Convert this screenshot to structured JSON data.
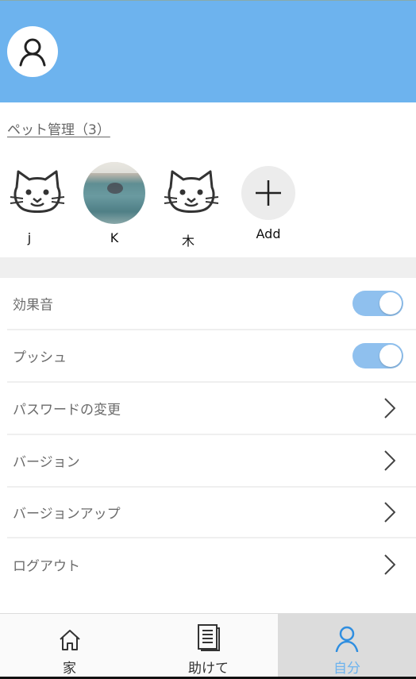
{
  "pets_section": {
    "title": "ペット管理（3）",
    "pets": [
      {
        "name": "j"
      },
      {
        "name": "K"
      },
      {
        "name": "木"
      }
    ],
    "add_label": "Add"
  },
  "settings": {
    "sound_effects": {
      "label": "効果音",
      "enabled": true
    },
    "push": {
      "label": "プッシュ",
      "enabled": true
    },
    "change_password": {
      "label": "パスワードの変更"
    },
    "version": {
      "label": "バージョン"
    },
    "version_up": {
      "label": "バージョンアップ"
    },
    "logout": {
      "label": "ログアウト"
    }
  },
  "tabbar": {
    "home": {
      "label": "家",
      "icon": "home-icon"
    },
    "help": {
      "label": "助けて",
      "icon": "document-icon"
    },
    "me": {
      "label": "自分",
      "icon": "user-icon",
      "active": true
    }
  },
  "colors": {
    "header": "#6db3ee",
    "toggle_on": "#8fc0ee",
    "active_tab_text": "#6db3ee"
  }
}
